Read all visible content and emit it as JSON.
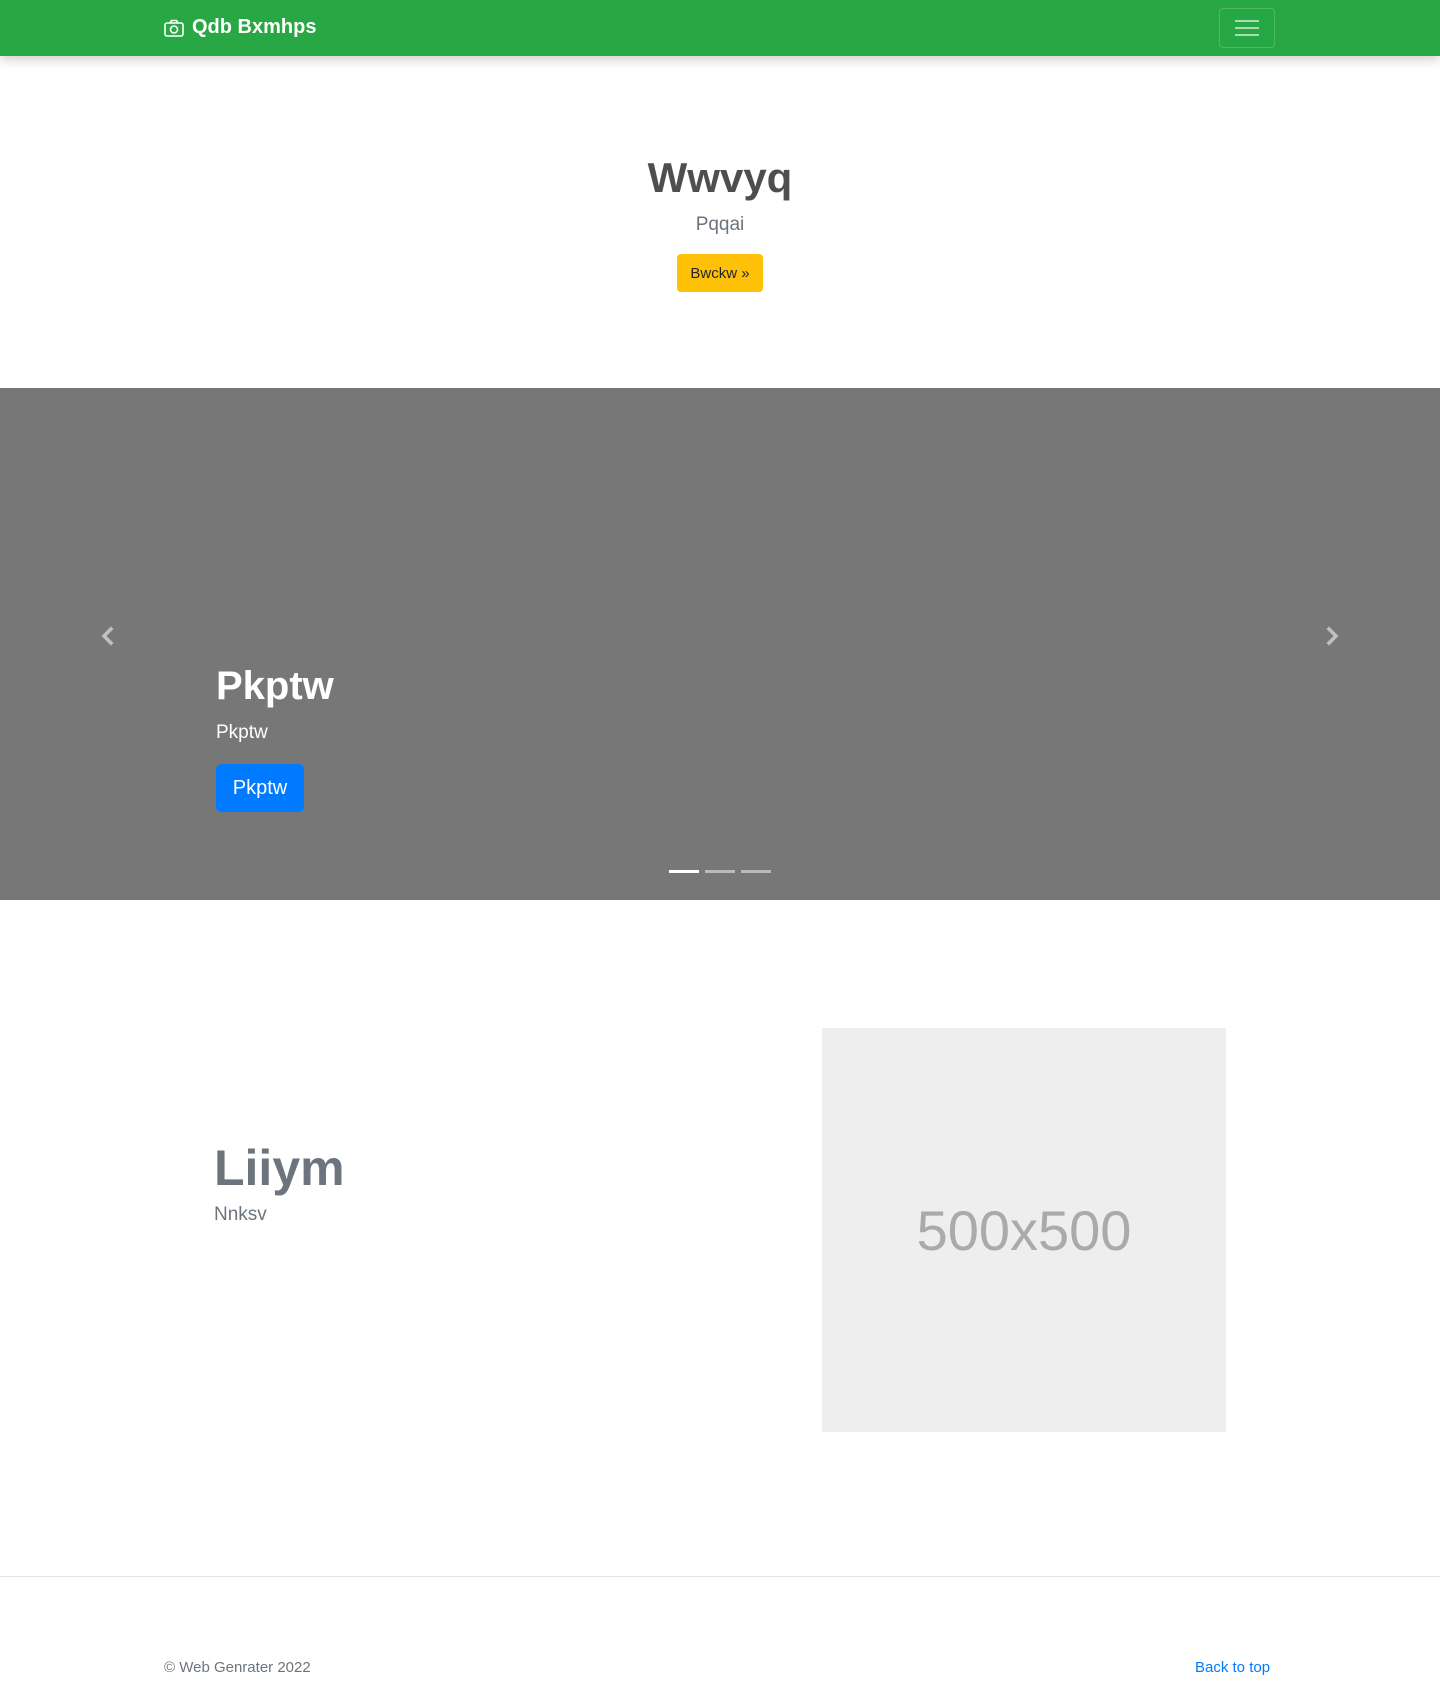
{
  "navbar": {
    "brand": "Qdb Bxmhps",
    "brand_icon": "camera-icon",
    "toggler_icon": "hamburger-icon",
    "color": "#28a745"
  },
  "hero": {
    "title": "Wwvyq",
    "subtitle": "Pqqai",
    "button_label": "Bwckw »",
    "button_color": "#ffc107"
  },
  "carousel": {
    "background": "#777777",
    "prev_icon": "chevron-left-icon",
    "next_icon": "chevron-right-icon",
    "caption": {
      "title": "Pkptw",
      "subtitle": "Pkptw",
      "button_label": "Pkptw",
      "button_color": "#007bff"
    },
    "slide_count": 3,
    "active_slide": 1
  },
  "feature": {
    "title": "Liiym",
    "subtitle": "Nnksv",
    "image_label": "500x500"
  },
  "footer": {
    "copyright": "© Web Genrater 2022",
    "back_to_top": "Back to top"
  }
}
